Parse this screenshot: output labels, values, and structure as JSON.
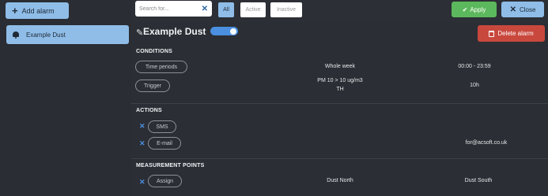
{
  "sidebar": {
    "add_label": "Add alarm",
    "items": [
      {
        "label": "Example Dust"
      }
    ]
  },
  "toolbar": {
    "search_placeholder": "Search for...",
    "filters": [
      "All",
      "Active",
      "Inactive"
    ],
    "apply_label": "Apply",
    "close_label": "Close"
  },
  "alarm": {
    "title": "Example Dust",
    "enabled": true,
    "delete_label": "Delete alarm"
  },
  "conditions": {
    "heading": "CONDITIONS",
    "rows": [
      {
        "button": "Time periods",
        "value": "Whole week",
        "extra": "00:00 - 23:59"
      },
      {
        "button": "Trigger",
        "value_line1": "PM 10 > 10 ug/m3",
        "value_line2": "TH",
        "extra": "10h"
      }
    ]
  },
  "actions": {
    "heading": "ACTIONS",
    "rows": [
      {
        "button": "SMS",
        "value": ""
      },
      {
        "button": "E-mail",
        "value": "for@acsoft.co.uk"
      }
    ]
  },
  "measurement_points": {
    "heading": "MEASUREMENT POINTS",
    "button": "Assign",
    "points": [
      "Dust North",
      "Dust South"
    ]
  },
  "colors": {
    "accent": "#8fbde8",
    "apply": "#5cb85c",
    "delete": "#c9483d",
    "toggle": "#4a8fe0",
    "background": "#2c2f35"
  },
  "icons": {
    "add": "plus-icon",
    "alarm": "bell-icon",
    "clear_search": "close-icon",
    "apply": "check-icon",
    "close": "close-icon",
    "edit": "pencil-icon",
    "delete": "trash-icon",
    "remove": "close-icon"
  }
}
